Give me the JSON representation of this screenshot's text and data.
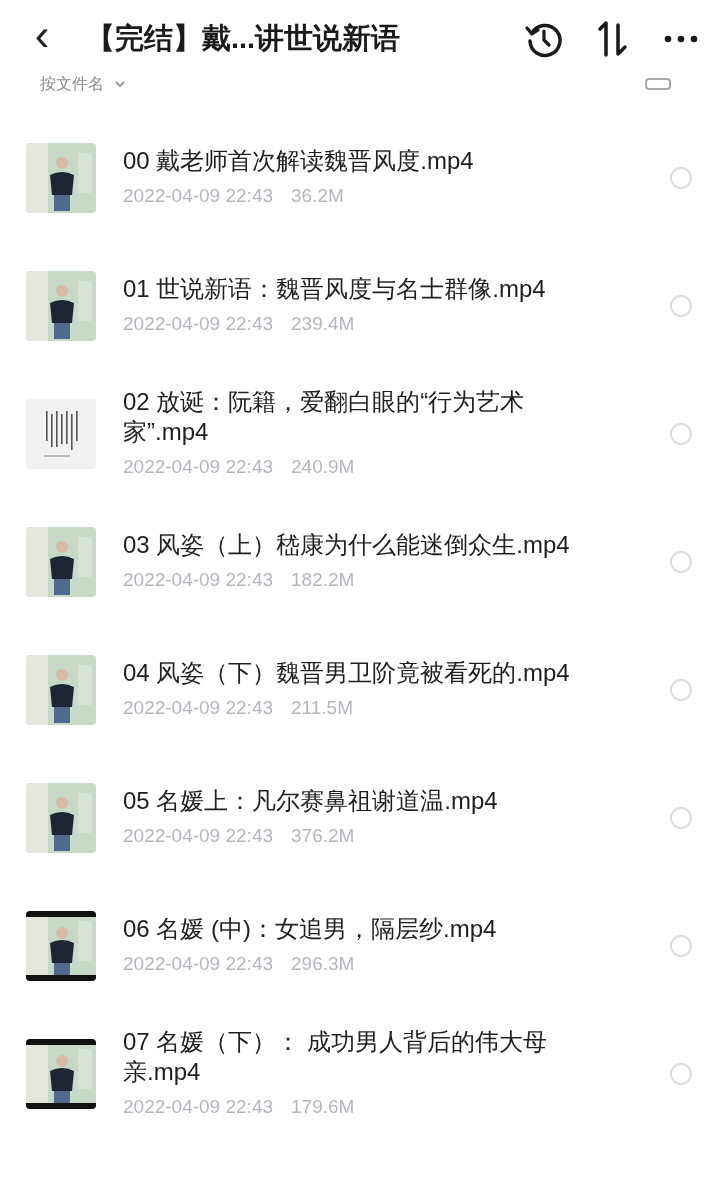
{
  "header": {
    "back": "‹",
    "title": "【完结】戴...讲世说新语"
  },
  "sort_bar": {
    "label": "按文件名"
  },
  "files": [
    {
      "name": "00 戴老师首次解读魏晋风度.mp4",
      "date": "2022-04-09 22:43",
      "size": "36.2M",
      "selected": false
    },
    {
      "name": "01 世说新语：魏晋风度与名士群像.mp4",
      "date": "2022-04-09 22:43",
      "size": "239.4M",
      "selected": false
    },
    {
      "name": "02 放诞：阮籍，爱翻白眼的“行为艺术家”.mp4",
      "date": "2022-04-09 22:43",
      "size": "240.9M",
      "selected": false
    },
    {
      "name": "03 风姿（上）嵇康为什么能迷倒众生.mp4",
      "date": "2022-04-09 22:43",
      "size": "182.2M",
      "selected": false
    },
    {
      "name": "04 风姿（下）魏晋男卫阶竟被看死的.mp4",
      "date": "2022-04-09 22:43",
      "size": "211.5M",
      "selected": false
    },
    {
      "name": "05 名媛上：凡尔赛鼻祖谢道温.mp4",
      "date": "2022-04-09 22:43",
      "size": "376.2M",
      "selected": false
    },
    {
      "name": "06 名媛 (中)：女追男，隔层纱.mp4",
      "date": "2022-04-09 22:43",
      "size": "296.3M",
      "selected": false
    },
    {
      "name": "07 名媛（下）： 成功男人背后的伟大母亲.mp4",
      "date": "2022-04-09 22:43",
      "size": "179.6M",
      "selected": false
    }
  ]
}
